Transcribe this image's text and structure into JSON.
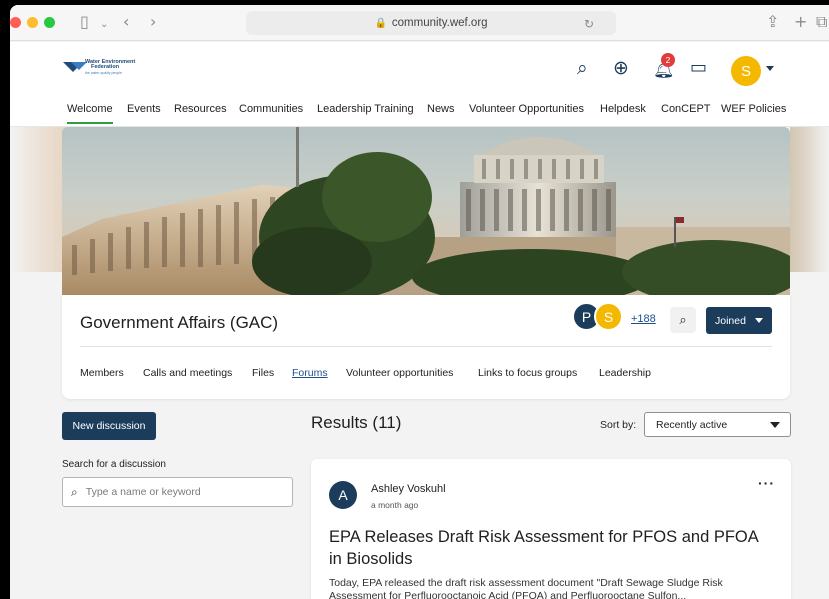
{
  "browser": {
    "url": "community.wef.org",
    "colors": {
      "close": "#ff5f57",
      "minimize": "#febc2e",
      "zoom": "#28c840"
    }
  },
  "header": {
    "logo_line1": "Water Environment",
    "logo_line2": "Federation",
    "logo_tagline": "the water quality people",
    "notification_count": "2",
    "avatar_initial": "S",
    "brand_color": "#1c3c5c"
  },
  "topnav": {
    "items": [
      {
        "label": "Welcome",
        "active": true
      },
      {
        "label": "Events"
      },
      {
        "label": "Resources"
      },
      {
        "label": "Communities"
      },
      {
        "label": "Leadership Training"
      },
      {
        "label": "News"
      },
      {
        "label": "Volunteer Opportunities"
      },
      {
        "label": "Helpdesk"
      },
      {
        "label": "ConCEPT"
      },
      {
        "label": "WEF Policies"
      }
    ]
  },
  "group": {
    "title": "Government Affairs (GAC)",
    "members": [
      {
        "initial": "P",
        "color": "#1c3c5c"
      },
      {
        "initial": "S",
        "color": "#f5b800"
      }
    ],
    "more_members": "+188",
    "joined_label": "Joined",
    "tabs": [
      {
        "label": "Members"
      },
      {
        "label": "Calls and meetings"
      },
      {
        "label": "Files"
      },
      {
        "label": "Forums",
        "active": true
      },
      {
        "label": "Volunteer opportunities"
      },
      {
        "label": "Links to focus groups"
      },
      {
        "label": "Leadership"
      }
    ]
  },
  "sidebar": {
    "new_discussion": "New discussion",
    "search_label": "Search for a discussion",
    "search_placeholder": "Type a name or keyword"
  },
  "results": {
    "heading": "Results (11)",
    "sort_label": "Sort by:",
    "sort_value": "Recently active"
  },
  "post": {
    "avatar_initial": "A",
    "author": "Ashley Voskuhl",
    "time": "a month ago",
    "title": "EPA Releases Draft Risk Assessment for PFOS and PFOA in Biosolids",
    "excerpt": "Today, EPA released the draft risk assessment document \"Draft Sewage Sludge Risk Assessment for Perfluorooctanoic Acid (PFOA) and Perfluorooctane Sulfon..."
  }
}
